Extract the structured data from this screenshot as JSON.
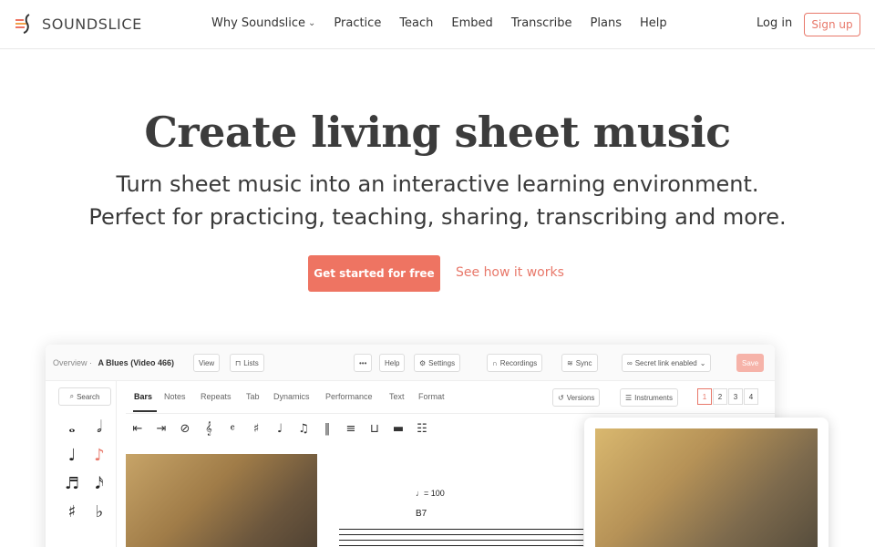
{
  "brand": {
    "name": "SOUNDSLICE",
    "accent": "#ee7462"
  },
  "nav": {
    "items": [
      {
        "label": "Why Soundslice",
        "dropdown": true
      },
      {
        "label": "Practice"
      },
      {
        "label": "Teach"
      },
      {
        "label": "Embed"
      },
      {
        "label": "Transcribe"
      },
      {
        "label": "Plans"
      },
      {
        "label": "Help"
      }
    ],
    "login": "Log in",
    "signup": "Sign up"
  },
  "hero": {
    "title": "Create living sheet music",
    "subtitle_line1": "Turn sheet music into an interactive learning environment.",
    "subtitle_line2": "Perfect for practicing, teaching, sharing, transcribing and more.",
    "cta_primary": "Get started for free",
    "cta_secondary": "See how it works"
  },
  "app": {
    "crumb_root": "Overview",
    "crumb_title": "A Blues (Video 466)",
    "buttons": {
      "view": "View",
      "lists": "Lists",
      "more": "•••",
      "help": "Help",
      "settings": "Settings",
      "recordings": "Recordings",
      "sync": "Sync",
      "secret_link": "Secret link enabled",
      "save": "Save"
    },
    "sidebar_search": "Search",
    "tabs": [
      "Bars",
      "Notes",
      "Repeats",
      "Tab",
      "Dynamics",
      "Performance",
      "Text",
      "Format"
    ],
    "versions": "Versions",
    "instruments": "Instruments",
    "pages": [
      "1",
      "2",
      "3",
      "4"
    ],
    "tempo": "♩= 100",
    "chord": "B7"
  }
}
